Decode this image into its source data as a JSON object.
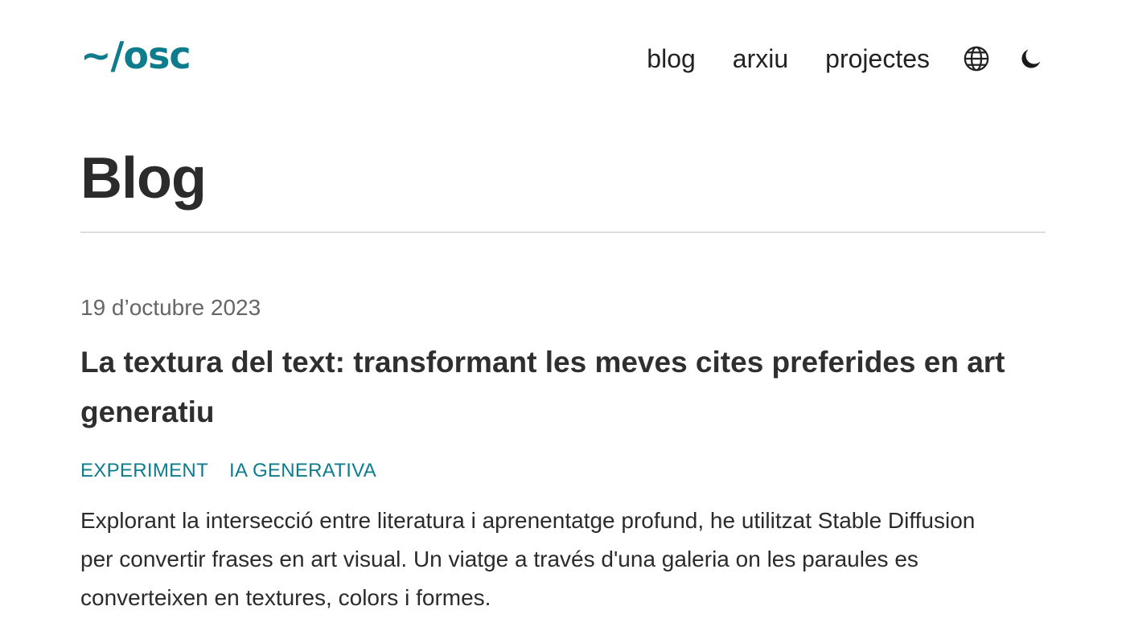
{
  "site": {
    "logo": "~/osc"
  },
  "nav": {
    "items": [
      {
        "label": "blog"
      },
      {
        "label": "arxiu"
      },
      {
        "label": "projectes"
      }
    ],
    "language_icon": "globe-icon",
    "theme_icon": "moon-icon"
  },
  "page": {
    "title": "Blog"
  },
  "post": {
    "date": "19 d’octubre 2023",
    "title": "La textura del text: transformant les meves cites preferides en art generatiu",
    "tags": [
      "EXPERIMENT",
      "IA GENERATIVA"
    ],
    "excerpt": "Explorant la intersecció entre literatura i aprenentatge profund, he utilitzat Stable Diffusion per convertir frases en art visual. Un viatge a través d'una galeria on les paraules es converteixen en textures, colors i formes."
  },
  "colors": {
    "accent": "#0e7c8c",
    "text": "#2b2b2b",
    "muted": "#666666",
    "divider": "#dcdcdc"
  }
}
